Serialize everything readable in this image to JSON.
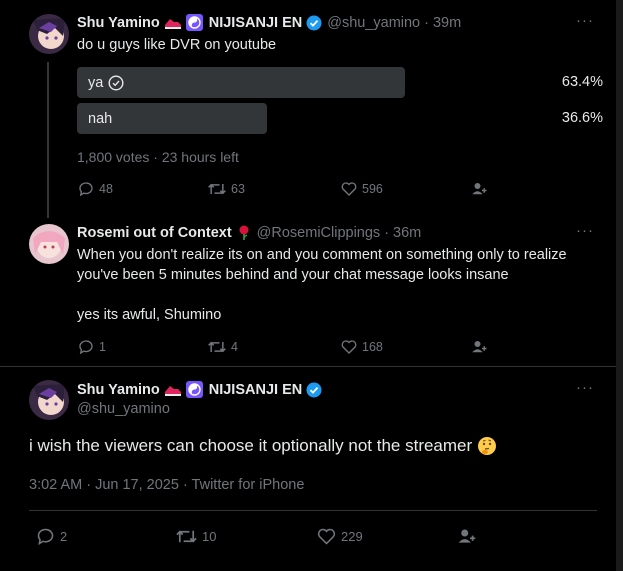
{
  "tweet1": {
    "name": "Shu Yamino",
    "affiliation": "NIJISANJI EN",
    "handle": "@shu_yamino",
    "time": "· 39m",
    "text": "do u guys like DVR on youtube",
    "poll": {
      "options": [
        {
          "label": "ya",
          "percent": "63.4%",
          "value": 63.4,
          "winner": true
        },
        {
          "label": "nah",
          "percent": "36.6%",
          "value": 36.6,
          "winner": false
        }
      ],
      "summary": "1,800 votes · 23 hours left"
    },
    "stats": {
      "replies": "48",
      "retweets": "63",
      "likes": "596"
    }
  },
  "tweet2": {
    "name": "Rosemi out of Context",
    "handle": "@RosemiClippings",
    "time": "· 36m",
    "text_line1": "When you don't realize its on and you comment on something only to realize",
    "text_line2": "you've been 5 minutes behind and your chat message looks insane",
    "text_line3": "yes its awful, Shumino",
    "stats": {
      "replies": "1",
      "retweets": "4",
      "likes": "168"
    }
  },
  "tweet3": {
    "name": "Shu Yamino",
    "affiliation": "NIJISANJI EN",
    "handle": "@shu_yamino",
    "text": "i wish the viewers can choose it optionally not the streamer",
    "meta": "3:02 AM · Jun 17, 2025 · Twitter for iPhone",
    "stats": {
      "replies": "2",
      "retweets": "10",
      "likes": "229"
    }
  },
  "icons": {
    "more": "···",
    "verified_color": "#1d9bf0",
    "accent_purple": "#7856ff"
  }
}
